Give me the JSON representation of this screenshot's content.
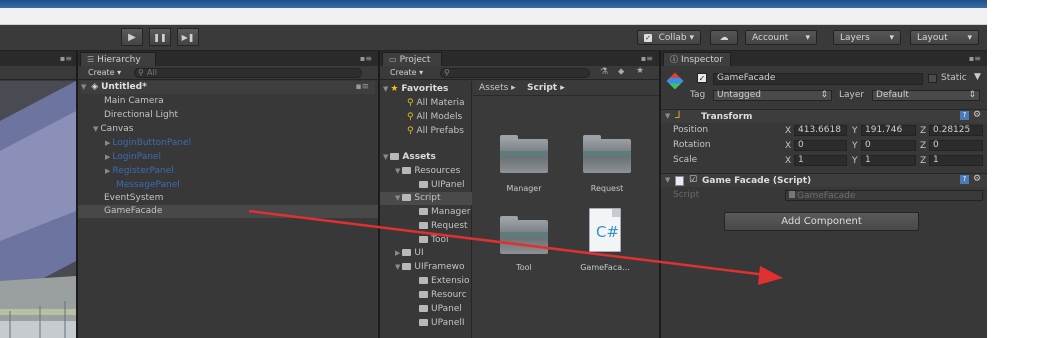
{
  "toolbar": {
    "play_glyph": "▶",
    "pause_glyph": "❚❚",
    "step_glyph": "▶❚",
    "collab": "Collab ▾",
    "account": "Account",
    "layers": "Layers",
    "layout": "Layout",
    "dropdown_glyph": "▾"
  },
  "hierarchy": {
    "tab": "Hierarchy",
    "create": "Create ▾",
    "search_placeholder": "All",
    "scene": "Untitled*",
    "items": {
      "main_camera": "Main Camera",
      "directional_light": "Directional Light",
      "canvas": "Canvas",
      "login_button_panel": "LoginButtonPanel",
      "login_panel": "LoginPanel",
      "register_panel": "RegisterPanel",
      "message_panel": "MessagePanel",
      "event_system": "EventSystem",
      "game_facade": "GameFacade"
    }
  },
  "project": {
    "tab": "Project",
    "create": "Create ▾",
    "favorites": "Favorites",
    "fav_materials": "All Materia",
    "fav_models": "All Models",
    "fav_prefabs": "All Prefabs",
    "assets": "Assets",
    "resources": "Resources",
    "uipanel": "UIPanel",
    "script": "Script",
    "manager": "Manager",
    "request": "Request",
    "tool": "Tool",
    "ui": "UI",
    "uiframework": "UIFramewo",
    "extension": "Extensio",
    "resource": "Resourc",
    "upanel": "UPanel",
    "upanel2": "UPanelI",
    "breadcrumb_assets": "Assets ▸",
    "breadcrumb_script": "Script ▸",
    "grid": {
      "manager": "Manager",
      "request": "Request",
      "tool": "Tool",
      "gamefacade": "GameFaca...",
      "cs_glyph": "C#"
    }
  },
  "inspector": {
    "tab": "Inspector",
    "object_name": "GameFacade",
    "static": "Static",
    "tag_label": "Tag",
    "tag_value": "Untagged",
    "layer_label": "Layer",
    "layer_value": "Default",
    "transform": "Transform",
    "position": "Position",
    "rotation": "Rotation",
    "scale": "Scale",
    "x": "X",
    "y": "Y",
    "z": "Z",
    "pos_x": "413.6618",
    "pos_y": "191.746",
    "pos_z": "0.28125",
    "rot_x": "0",
    "rot_y": "0",
    "rot_z": "0",
    "scl_x": "1",
    "scl_y": "1",
    "scl_z": "1",
    "script_component": "Game Facade (Script)",
    "script_label": "Script",
    "script_value": "GameFacade",
    "add_component": "Add Component"
  },
  "colors": {
    "annotation_arrow": "#e03030",
    "disabled_item": "#3d6bb0"
  }
}
